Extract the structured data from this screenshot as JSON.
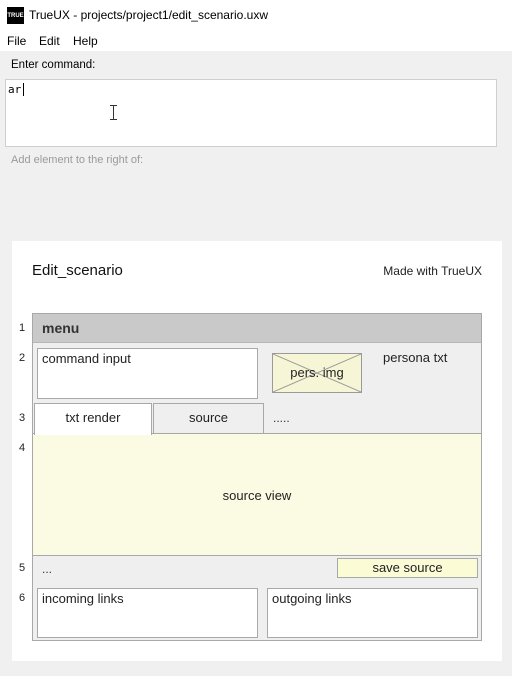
{
  "window": {
    "logo_text": "TRUE",
    "title": "TrueUX - projects/project1/edit_scenario.uxw"
  },
  "menubar": {
    "items": [
      "File",
      "Edit",
      "Help"
    ]
  },
  "command": {
    "label": "Enter command:",
    "value": "ar",
    "hint": "Add element to the right of:"
  },
  "canvas": {
    "scenario_title": "Edit_scenario",
    "made_with": "Made with TrueUX",
    "row_numbers": [
      "1",
      "2",
      "3",
      "4",
      "5",
      "6"
    ],
    "menu_label": "menu",
    "command_input_label": "command input",
    "persona_img_label": "pers. img",
    "persona_txt_label": "persona txt",
    "tabs": [
      "txt render",
      "source"
    ],
    "tabs_more": ".....",
    "source_view_label": "source view",
    "row5_ellipsis": "...",
    "save_source_label": "save source",
    "incoming_links_label": "incoming links",
    "outgoing_links_label": "outgoing links"
  },
  "colors": {
    "menu_band": "#c9c9c9",
    "source_view_bg": "#fbfbe4",
    "placeholder_bg": "#f6f6d6"
  }
}
